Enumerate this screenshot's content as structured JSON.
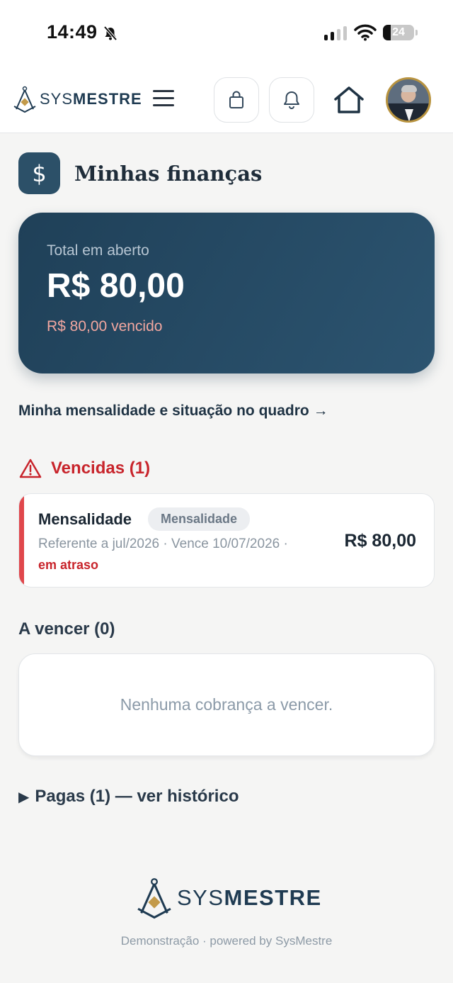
{
  "status_bar": {
    "time": "14:49",
    "battery": "24",
    "battery_level": 0.24
  },
  "header": {
    "logo": "SYSMESTRE",
    "logo_parts": [
      "SYS",
      "MESTRE"
    ]
  },
  "page": {
    "title": "Minhas finanças",
    "title_icon": "$"
  },
  "summary": {
    "label": "Total em aberto",
    "total": "R$ 80,00",
    "overdue": "R$ 80,00 vencido"
  },
  "link": {
    "label": "Minha mensalidade e situação no quadro →"
  },
  "overdue_section": {
    "title": "Vencidas (1)",
    "items": [
      {
        "name": "Mensalidade",
        "tag": "Mensalidade",
        "meta": "Referente a jul/2026 · Vence 10/07/2026 ·",
        "status": "em atraso",
        "amount": "R$ 80,00"
      }
    ]
  },
  "upcoming_section": {
    "title": "A vencer (0)",
    "empty_text": "Nenhuma cobrança a vencer."
  },
  "paid_section": {
    "label": "Pagas (1) — ver histórico",
    "icon": "▶"
  },
  "footer": {
    "logo_parts": [
      "SYS",
      "MESTRE"
    ],
    "note": "Demonstração · powered by SysMestre"
  },
  "colors": {
    "primary": "#2c5068",
    "danger": "#c8242b",
    "accent_gold": "#b8933f"
  }
}
